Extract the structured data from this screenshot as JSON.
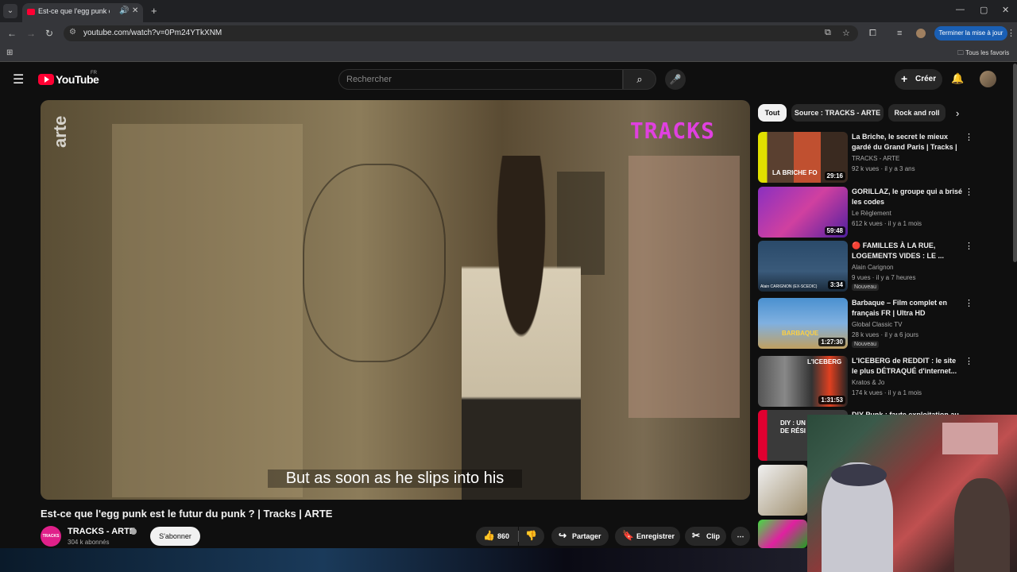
{
  "browser": {
    "tab_title": "Est-ce que l'egg punk est le",
    "url": "youtube.com/watch?v=0Pm24YTkXNM",
    "update_button": "Terminer la mise à jour",
    "bookmarks_folder": "Tous les favoris",
    "icons": [
      "chevron-down-icon",
      "speaker-icon",
      "close-icon",
      "plus-icon",
      "back-icon",
      "forward-icon",
      "reload-icon",
      "tune-icon",
      "install-icon",
      "star-icon",
      "extensions-icon",
      "media-icon",
      "kebab-icon",
      "apps-icon",
      "folder-icon"
    ]
  },
  "youtube": {
    "logo_text": "YouTube",
    "region": "FR",
    "search_placeholder": "Rechercher",
    "create_label": "Créer"
  },
  "video": {
    "overlay_arte": "arte",
    "overlay_tracks": "TRACKS",
    "subtitle": "But as soon as he slips into his",
    "title": "Est-ce que l'egg punk est le futur du punk ? | Tracks | ARTE",
    "channel": "TRACKS - ARTE",
    "channel_avatar_text": "TRACKS",
    "subscribers": "304 k abonnés",
    "subscribe_label": "S'abonner",
    "likes": "860",
    "share_label": "Partager",
    "save_label": "Enregistrer",
    "clip_label": "Clip"
  },
  "chips": [
    "Tout",
    "Source : TRACKS - ARTE",
    "Rock and roll"
  ],
  "recommendations": [
    {
      "title": "La Briche,  le secret le mieux gardé du Grand Paris | Tracks | ...",
      "channel": "TRACKS - ARTE",
      "meta": "92 k vues · il y a 3 ans",
      "duration": "29:16",
      "thumb_text": "LA BRICHE FO",
      "new": ""
    },
    {
      "title": "GORILLAZ, le groupe qui a brisé les codes",
      "channel": "Le Règlement",
      "meta": "612 k vues · il y a 1 mois",
      "duration": "59:48",
      "thumb_text": "",
      "new": ""
    },
    {
      "title": "🔴 FAMILLES À LA RUE, LOGEMENTS VIDES : LE ...",
      "channel": "Alain Carignon",
      "meta": "9 vues · il y a 7 heures",
      "duration": "3:34",
      "thumb_text": "Alain CARIGNON (EX-SCEDIC)",
      "new": "Nouveau"
    },
    {
      "title": "Barbaque – Film complet en français FR | Ultra HD",
      "channel": "Global Classic TV",
      "meta": "28 k vues · il y a 6 jours",
      "duration": "1:27:30",
      "thumb_text": "BARBAQUE",
      "new": "Nouveau"
    },
    {
      "title": "L'ICEBERG de REDDIT : le site le plus DÉTRAQUÉ d'internet...",
      "channel": "Kratos & Jo",
      "meta": "174 k vues · il y a 1 mois",
      "duration": "1:31:53",
      "thumb_text": "L'ICEBERG",
      "new": ""
    },
    {
      "title": "DIY Punk : faute exploitation au",
      "channel": "",
      "meta": "",
      "duration": "",
      "thumb_text": "DIY : UN DE RÉSI",
      "new": ""
    }
  ]
}
